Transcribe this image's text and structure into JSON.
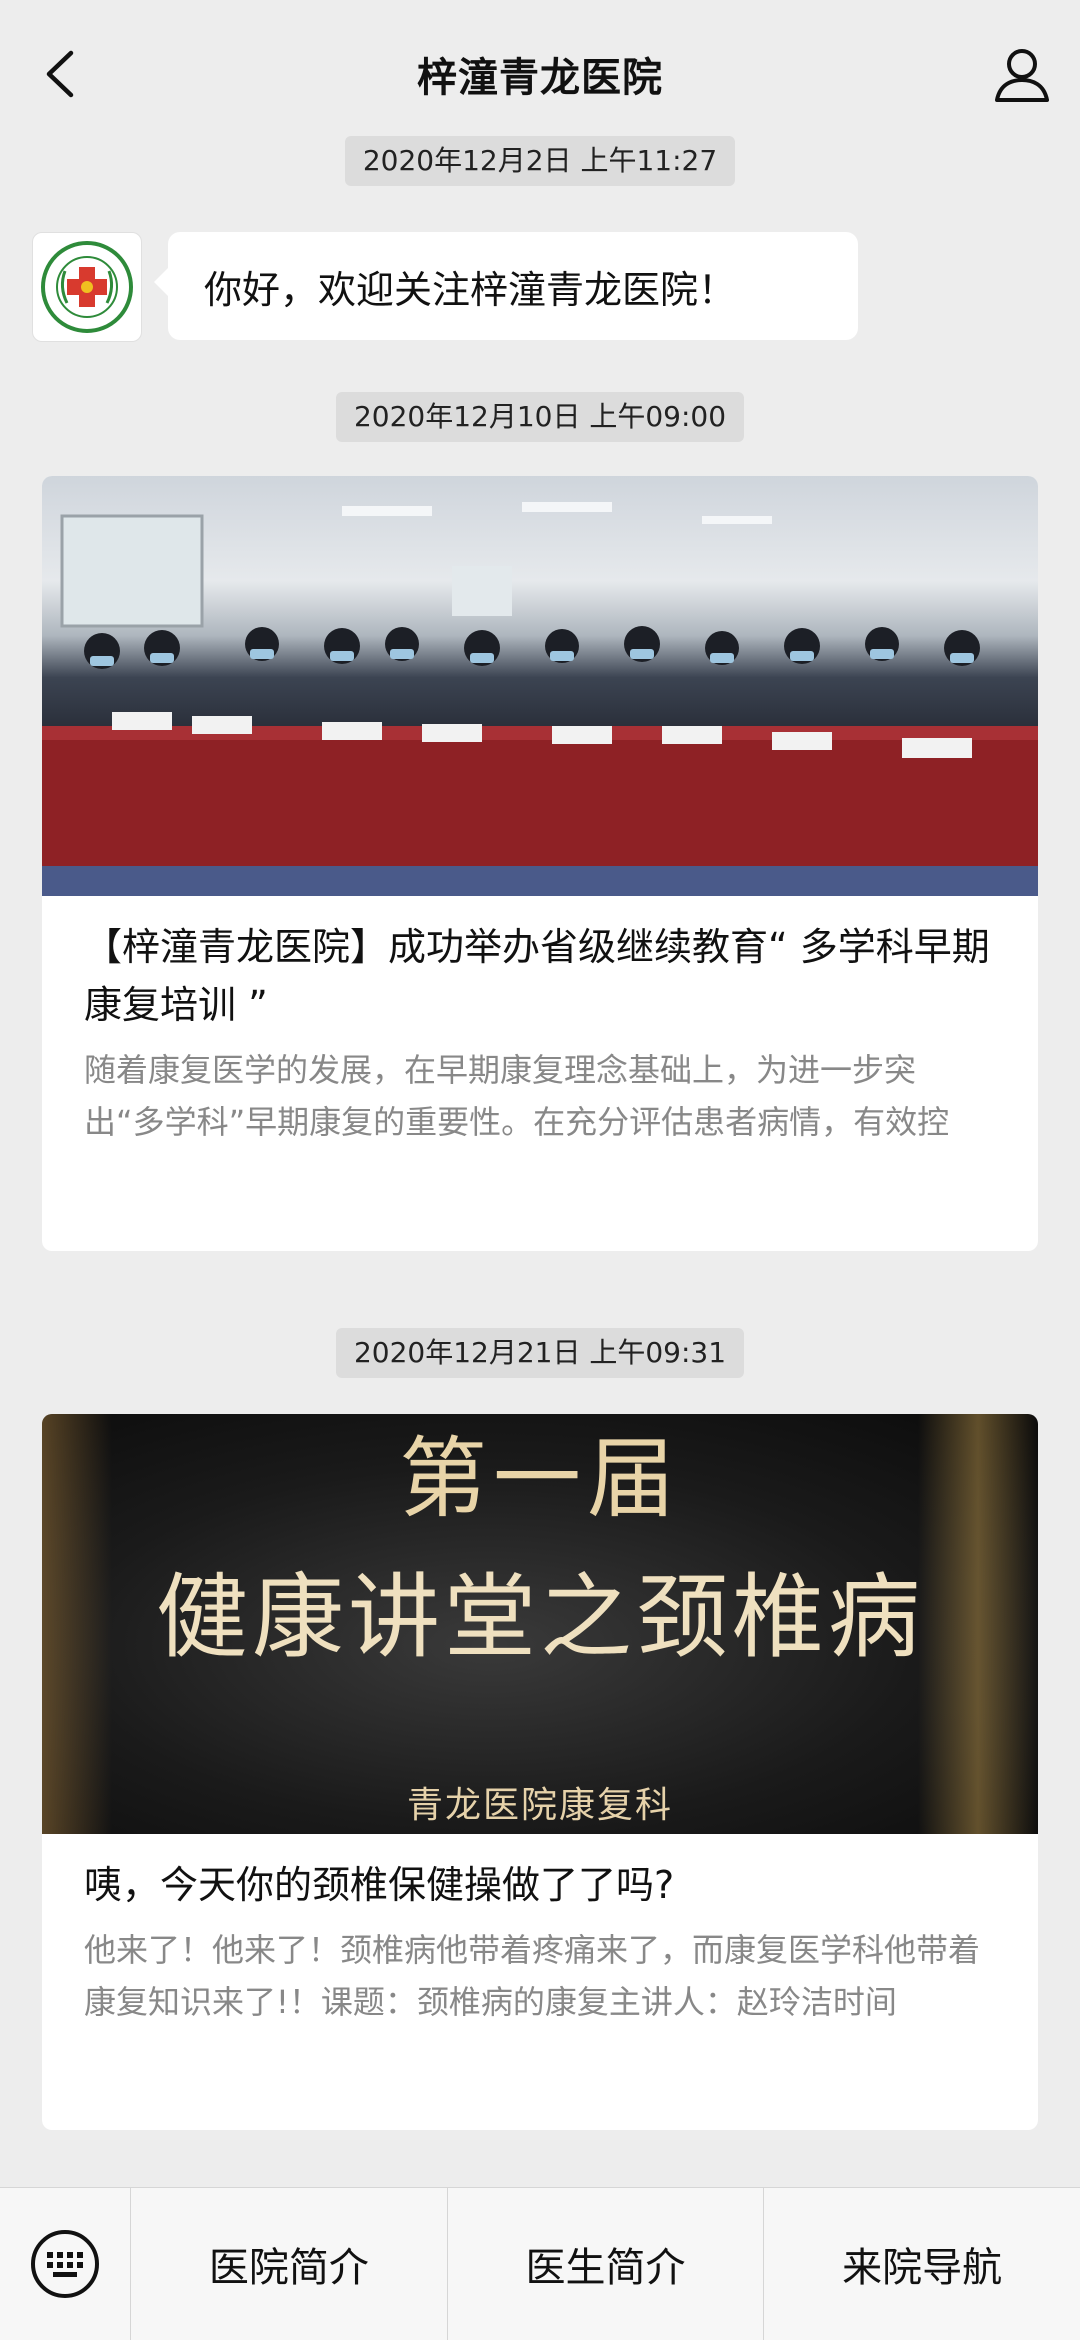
{
  "header": {
    "title": "梓潼青龙医院",
    "back_icon": "chevron-left-icon",
    "user_icon": "person-icon"
  },
  "messages": {
    "ts1": "2020年12月2日 上午11:27",
    "welcome": "你好，欢迎关注梓潼青龙医院！",
    "ts2": "2020年12月10日 上午09:00",
    "ts3": "2020年12月21日 上午09:31"
  },
  "articles": [
    {
      "title": "【梓潼青龙医院】成功举办省级继续教育“ 多学科早期康复培训 ”",
      "desc": "随着康复医学的发展，在早期康复理念基础上，为进一步突出“多学科”早期康复的重要性。在充分评估患者病情，有效控"
    },
    {
      "poster_top": "第一届",
      "poster_main": "健康讲堂之颈椎病",
      "poster_sub": "青龙医院康复科",
      "title": "咦，今天你的颈椎保健操做了了吗?",
      "desc": "他来了！他来了！颈椎病他带着疼痛来了，而康复医学科他带着康复知识来了!！课题：颈椎病的康复主讲人：赵玲洁时间"
    }
  ],
  "bottom_menu": [
    "医院简介",
    "医生简介",
    "来院导航"
  ],
  "colors": {
    "background": "#ededed",
    "card": "#ffffff",
    "desc_text": "#888888",
    "logo_green": "#2e8b3a",
    "logo_red": "#d83a2e"
  }
}
